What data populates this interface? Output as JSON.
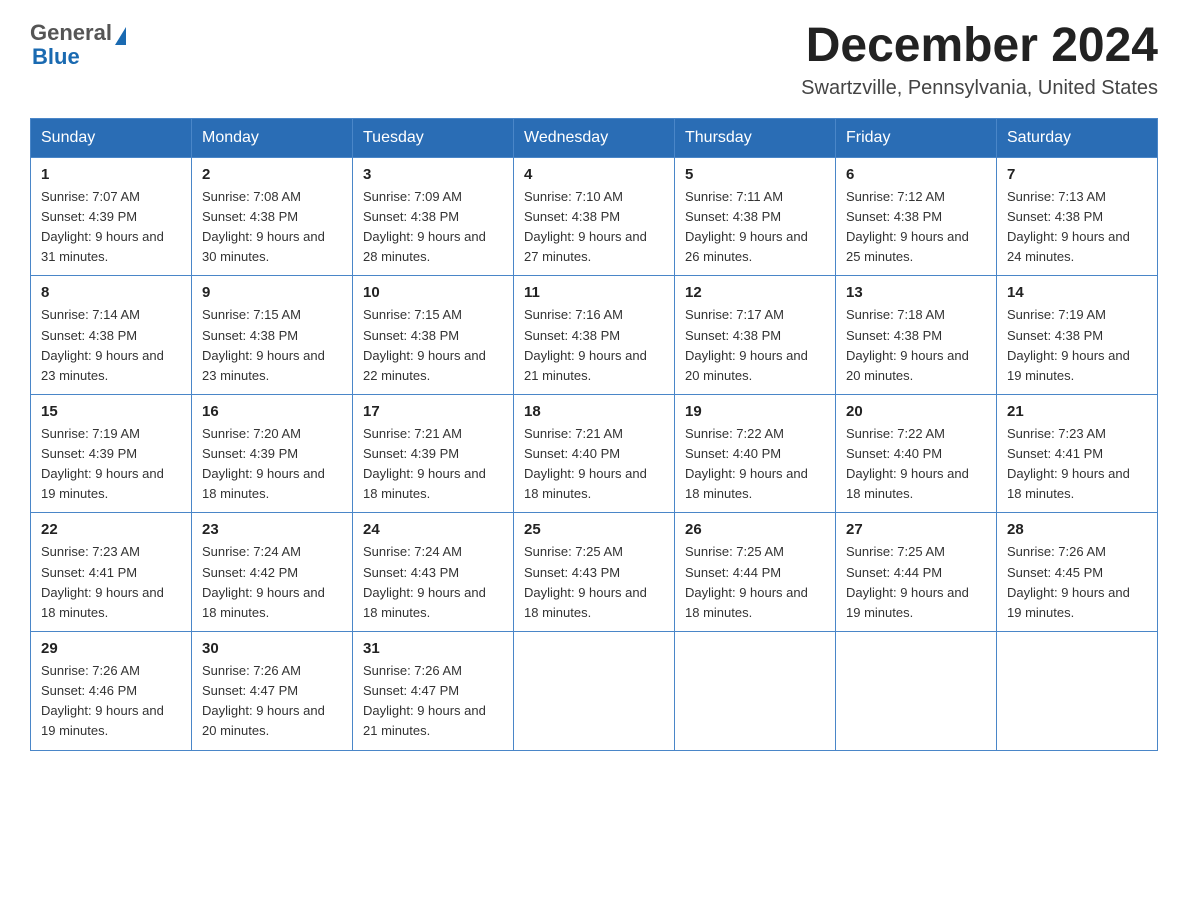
{
  "header": {
    "logo_general": "General",
    "logo_blue": "Blue",
    "month_title": "December 2024",
    "location": "Swartzville, Pennsylvania, United States"
  },
  "days_of_week": [
    "Sunday",
    "Monday",
    "Tuesday",
    "Wednesday",
    "Thursday",
    "Friday",
    "Saturday"
  ],
  "weeks": [
    [
      {
        "day": "1",
        "sunrise": "Sunrise: 7:07 AM",
        "sunset": "Sunset: 4:39 PM",
        "daylight": "Daylight: 9 hours and 31 minutes."
      },
      {
        "day": "2",
        "sunrise": "Sunrise: 7:08 AM",
        "sunset": "Sunset: 4:38 PM",
        "daylight": "Daylight: 9 hours and 30 minutes."
      },
      {
        "day": "3",
        "sunrise": "Sunrise: 7:09 AM",
        "sunset": "Sunset: 4:38 PM",
        "daylight": "Daylight: 9 hours and 28 minutes."
      },
      {
        "day": "4",
        "sunrise": "Sunrise: 7:10 AM",
        "sunset": "Sunset: 4:38 PM",
        "daylight": "Daylight: 9 hours and 27 minutes."
      },
      {
        "day": "5",
        "sunrise": "Sunrise: 7:11 AM",
        "sunset": "Sunset: 4:38 PM",
        "daylight": "Daylight: 9 hours and 26 minutes."
      },
      {
        "day": "6",
        "sunrise": "Sunrise: 7:12 AM",
        "sunset": "Sunset: 4:38 PM",
        "daylight": "Daylight: 9 hours and 25 minutes."
      },
      {
        "day": "7",
        "sunrise": "Sunrise: 7:13 AM",
        "sunset": "Sunset: 4:38 PM",
        "daylight": "Daylight: 9 hours and 24 minutes."
      }
    ],
    [
      {
        "day": "8",
        "sunrise": "Sunrise: 7:14 AM",
        "sunset": "Sunset: 4:38 PM",
        "daylight": "Daylight: 9 hours and 23 minutes."
      },
      {
        "day": "9",
        "sunrise": "Sunrise: 7:15 AM",
        "sunset": "Sunset: 4:38 PM",
        "daylight": "Daylight: 9 hours and 23 minutes."
      },
      {
        "day": "10",
        "sunrise": "Sunrise: 7:15 AM",
        "sunset": "Sunset: 4:38 PM",
        "daylight": "Daylight: 9 hours and 22 minutes."
      },
      {
        "day": "11",
        "sunrise": "Sunrise: 7:16 AM",
        "sunset": "Sunset: 4:38 PM",
        "daylight": "Daylight: 9 hours and 21 minutes."
      },
      {
        "day": "12",
        "sunrise": "Sunrise: 7:17 AM",
        "sunset": "Sunset: 4:38 PM",
        "daylight": "Daylight: 9 hours and 20 minutes."
      },
      {
        "day": "13",
        "sunrise": "Sunrise: 7:18 AM",
        "sunset": "Sunset: 4:38 PM",
        "daylight": "Daylight: 9 hours and 20 minutes."
      },
      {
        "day": "14",
        "sunrise": "Sunrise: 7:19 AM",
        "sunset": "Sunset: 4:38 PM",
        "daylight": "Daylight: 9 hours and 19 minutes."
      }
    ],
    [
      {
        "day": "15",
        "sunrise": "Sunrise: 7:19 AM",
        "sunset": "Sunset: 4:39 PM",
        "daylight": "Daylight: 9 hours and 19 minutes."
      },
      {
        "day": "16",
        "sunrise": "Sunrise: 7:20 AM",
        "sunset": "Sunset: 4:39 PM",
        "daylight": "Daylight: 9 hours and 18 minutes."
      },
      {
        "day": "17",
        "sunrise": "Sunrise: 7:21 AM",
        "sunset": "Sunset: 4:39 PM",
        "daylight": "Daylight: 9 hours and 18 minutes."
      },
      {
        "day": "18",
        "sunrise": "Sunrise: 7:21 AM",
        "sunset": "Sunset: 4:40 PM",
        "daylight": "Daylight: 9 hours and 18 minutes."
      },
      {
        "day": "19",
        "sunrise": "Sunrise: 7:22 AM",
        "sunset": "Sunset: 4:40 PM",
        "daylight": "Daylight: 9 hours and 18 minutes."
      },
      {
        "day": "20",
        "sunrise": "Sunrise: 7:22 AM",
        "sunset": "Sunset: 4:40 PM",
        "daylight": "Daylight: 9 hours and 18 minutes."
      },
      {
        "day": "21",
        "sunrise": "Sunrise: 7:23 AM",
        "sunset": "Sunset: 4:41 PM",
        "daylight": "Daylight: 9 hours and 18 minutes."
      }
    ],
    [
      {
        "day": "22",
        "sunrise": "Sunrise: 7:23 AM",
        "sunset": "Sunset: 4:41 PM",
        "daylight": "Daylight: 9 hours and 18 minutes."
      },
      {
        "day": "23",
        "sunrise": "Sunrise: 7:24 AM",
        "sunset": "Sunset: 4:42 PM",
        "daylight": "Daylight: 9 hours and 18 minutes."
      },
      {
        "day": "24",
        "sunrise": "Sunrise: 7:24 AM",
        "sunset": "Sunset: 4:43 PM",
        "daylight": "Daylight: 9 hours and 18 minutes."
      },
      {
        "day": "25",
        "sunrise": "Sunrise: 7:25 AM",
        "sunset": "Sunset: 4:43 PM",
        "daylight": "Daylight: 9 hours and 18 minutes."
      },
      {
        "day": "26",
        "sunrise": "Sunrise: 7:25 AM",
        "sunset": "Sunset: 4:44 PM",
        "daylight": "Daylight: 9 hours and 18 minutes."
      },
      {
        "day": "27",
        "sunrise": "Sunrise: 7:25 AM",
        "sunset": "Sunset: 4:44 PM",
        "daylight": "Daylight: 9 hours and 19 minutes."
      },
      {
        "day": "28",
        "sunrise": "Sunrise: 7:26 AM",
        "sunset": "Sunset: 4:45 PM",
        "daylight": "Daylight: 9 hours and 19 minutes."
      }
    ],
    [
      {
        "day": "29",
        "sunrise": "Sunrise: 7:26 AM",
        "sunset": "Sunset: 4:46 PM",
        "daylight": "Daylight: 9 hours and 19 minutes."
      },
      {
        "day": "30",
        "sunrise": "Sunrise: 7:26 AM",
        "sunset": "Sunset: 4:47 PM",
        "daylight": "Daylight: 9 hours and 20 minutes."
      },
      {
        "day": "31",
        "sunrise": "Sunrise: 7:26 AM",
        "sunset": "Sunset: 4:47 PM",
        "daylight": "Daylight: 9 hours and 21 minutes."
      },
      null,
      null,
      null,
      null
    ]
  ],
  "colors": {
    "header_bg": "#2a6db5",
    "header_text": "#ffffff",
    "border": "#4a86c8",
    "logo_general": "#555555",
    "logo_blue": "#1a6ab1"
  }
}
